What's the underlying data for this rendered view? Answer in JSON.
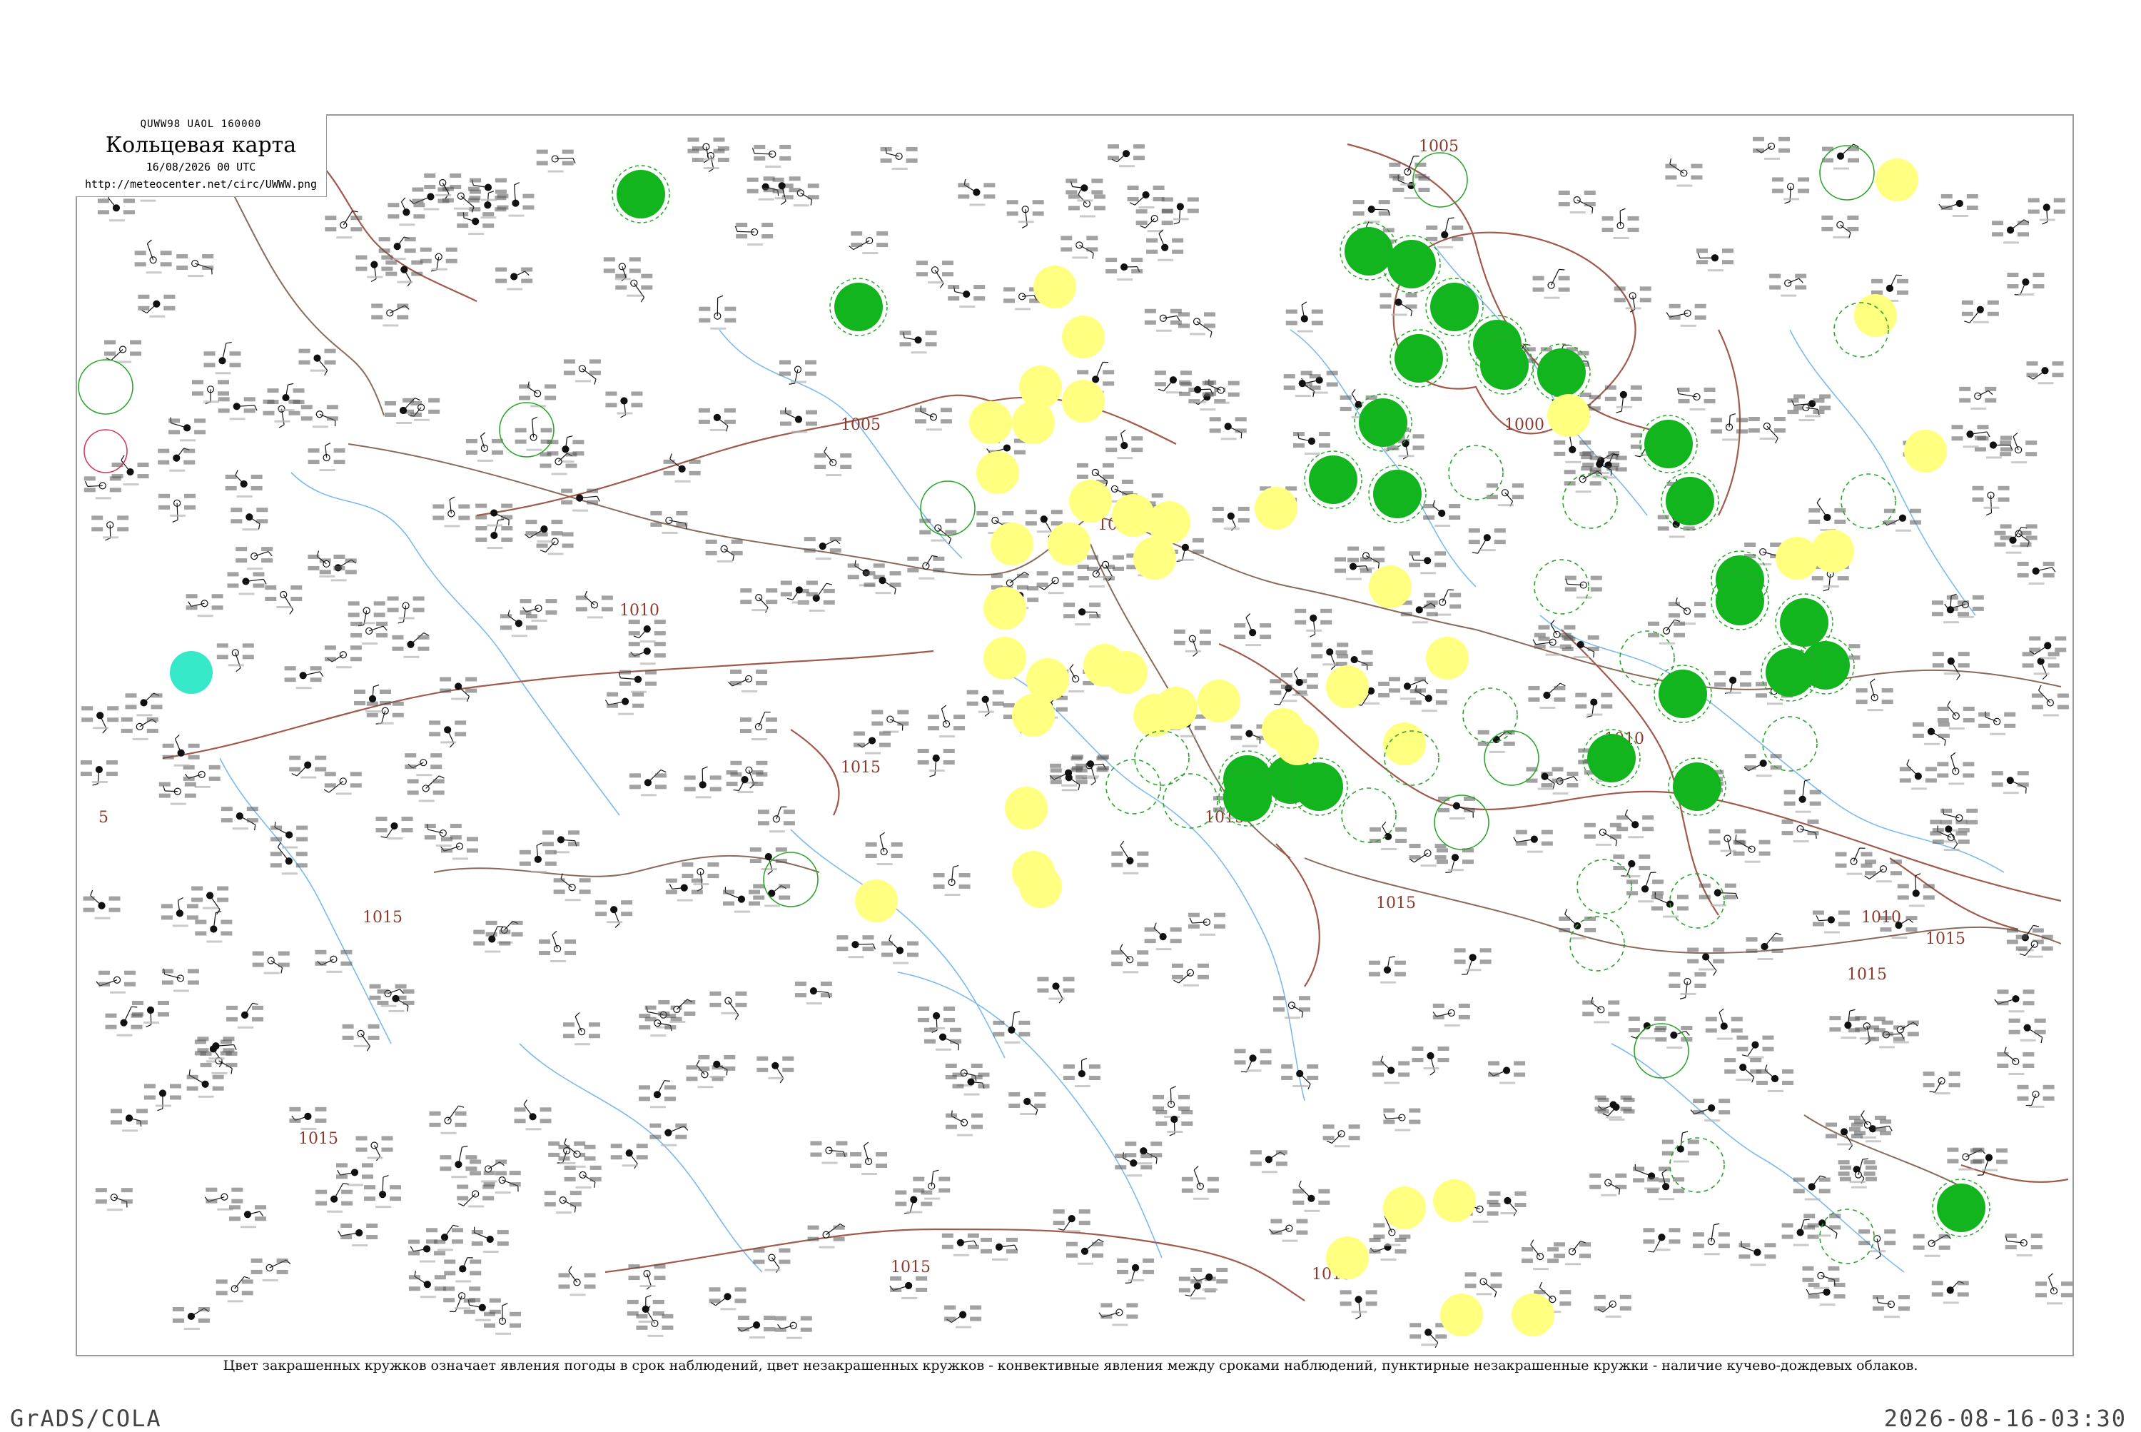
{
  "header": {
    "code": "QUWW98  UAOL  160000",
    "title": "Кольцевая карта",
    "date": "16/08/2026 00 UTC",
    "url": "http://meteocenter.net/circ/UWWW.png"
  },
  "isobars": [
    "1005",
    "1000",
    "1010",
    "1010",
    "1010",
    "1005",
    "1015",
    "1015",
    "1015",
    "1015",
    "1015",
    "1015",
    "1015",
    "1010",
    "1015",
    "1015",
    "5"
  ],
  "legend_colors": {
    "green_fill": "#13b51e",
    "yellow_fill": "#ffff80",
    "cyan_fill": "#34e8c8",
    "green_outline": "#2aa52a",
    "red_outline": "#d63a5a",
    "isobar": "#a0594a",
    "river": "#66aee8",
    "border": "#8a6a5a"
  },
  "footer": {
    "note": "Цвет закрашенных кружков означает явления погоды в срок наблюдений, цвет незакрашенных кружков - конвективные явления между сроками наблюдений, пунктирные незакрашенные кружки - наличие кучево-дождевых облаков."
  },
  "bottom": {
    "left": "GrADS/COLA",
    "right": "2026-08-16-03:30"
  }
}
